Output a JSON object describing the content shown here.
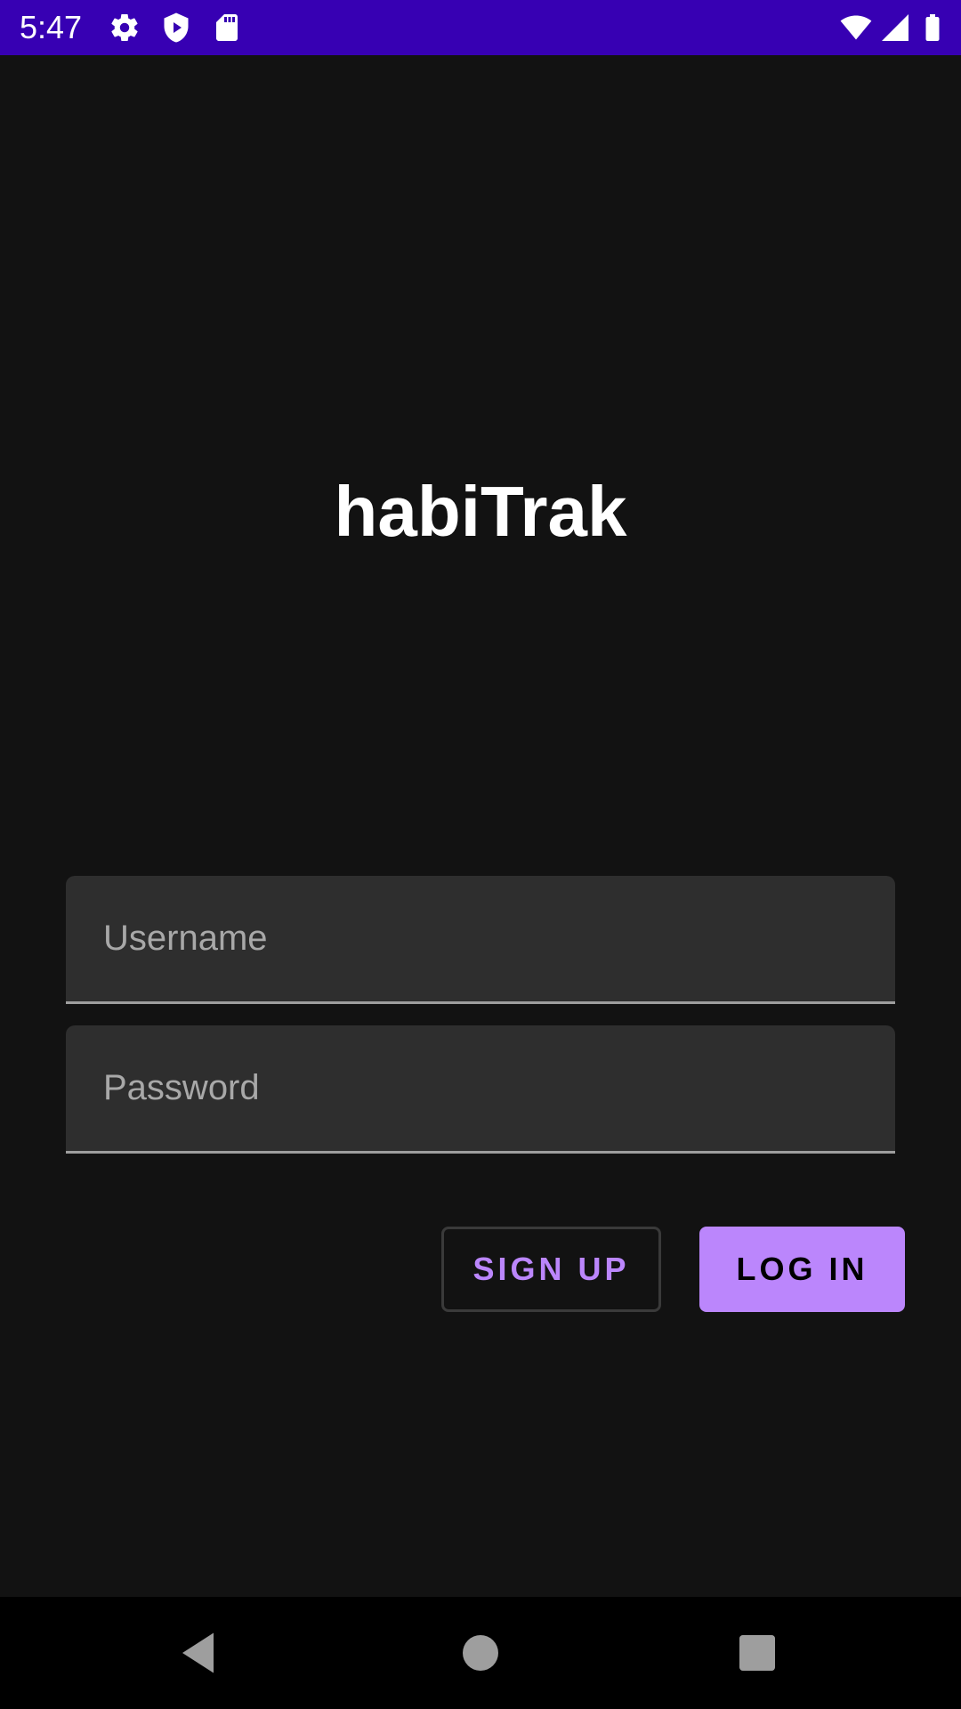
{
  "status_bar": {
    "time": "5:47",
    "left_icons": [
      "gear-icon",
      "shield-play-icon",
      "sd-card-icon"
    ],
    "right_icons": [
      "wifi-icon",
      "cell-signal-icon",
      "battery-icon"
    ],
    "background_color": "#3700b3"
  },
  "app": {
    "title": "habiTrak"
  },
  "login_form": {
    "username": {
      "placeholder": "Username",
      "value": ""
    },
    "password": {
      "placeholder": "Password",
      "value": ""
    },
    "signup_label": "SIGN UP",
    "login_label": "LOG IN",
    "accent_color": "#bb86fc"
  },
  "nav_bar": {
    "icons": [
      "back-icon",
      "home-icon",
      "recents-icon"
    ]
  }
}
